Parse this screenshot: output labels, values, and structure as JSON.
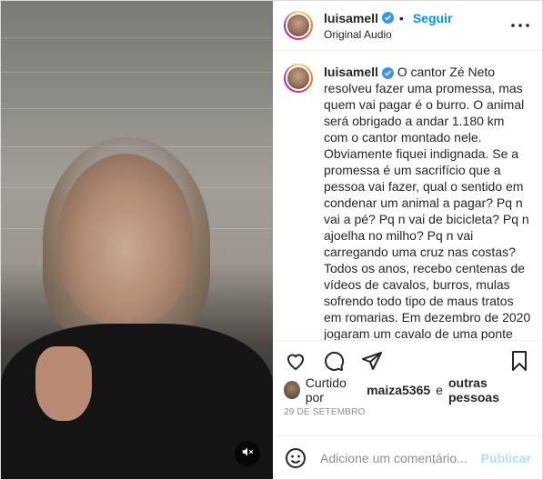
{
  "post": {
    "username": "luisamell",
    "follow_label": "Seguir",
    "audio": "Original Audio",
    "caption_username": "luisamell",
    "caption": "O cantor Zé Neto resolveu fazer uma promessa, mas quem vai pagar é o burro. O animal será obrigado a andar 1.180 km com o cantor montado nele. Obviamente fiquei indignada. Se a promessa é um sacrifício que a pessoa vai fazer, qual o sentido em condenar um animal a pagar? Pq n vai a pé? Pq n vai de bicicleta? Pq n ajoelha no milho? Pq n vai carregando uma cruz nas costas? Todos os anos, recebo centenas de vídeos de cavalos, burros, mulas sofrendo todo tipo de maus tratos em romarias. Em dezembro de 2020 jogaram um cavalo de uma ponte ainda vivo pq ele n aguentava mais andar!!!! Pois bem. Estou recebendo todo tipo de ataques de homens que que acham que podem explorar animais para tentar se",
    "liked_prefix": "Curtido por",
    "liked_user": "maiza5365",
    "liked_suffix": "e",
    "liked_others": "outras pessoas",
    "date": "29 DE SETEMBRO",
    "comment_placeholder": "Adicione um comentário...",
    "publish_label": "Publicar"
  },
  "icons": {
    "verified": "verified-badge-icon",
    "more": "more-options-icon",
    "like": "heart-icon",
    "comment": "comment-icon",
    "share": "share-icon",
    "save": "bookmark-icon",
    "emoji": "emoji-icon",
    "mute": "muted-speaker-icon"
  },
  "colors": {
    "accent": "#0095f6",
    "verified": "#3897f0",
    "publish_disabled": "#b2dffc",
    "muted_text": "#8e8e8e"
  }
}
